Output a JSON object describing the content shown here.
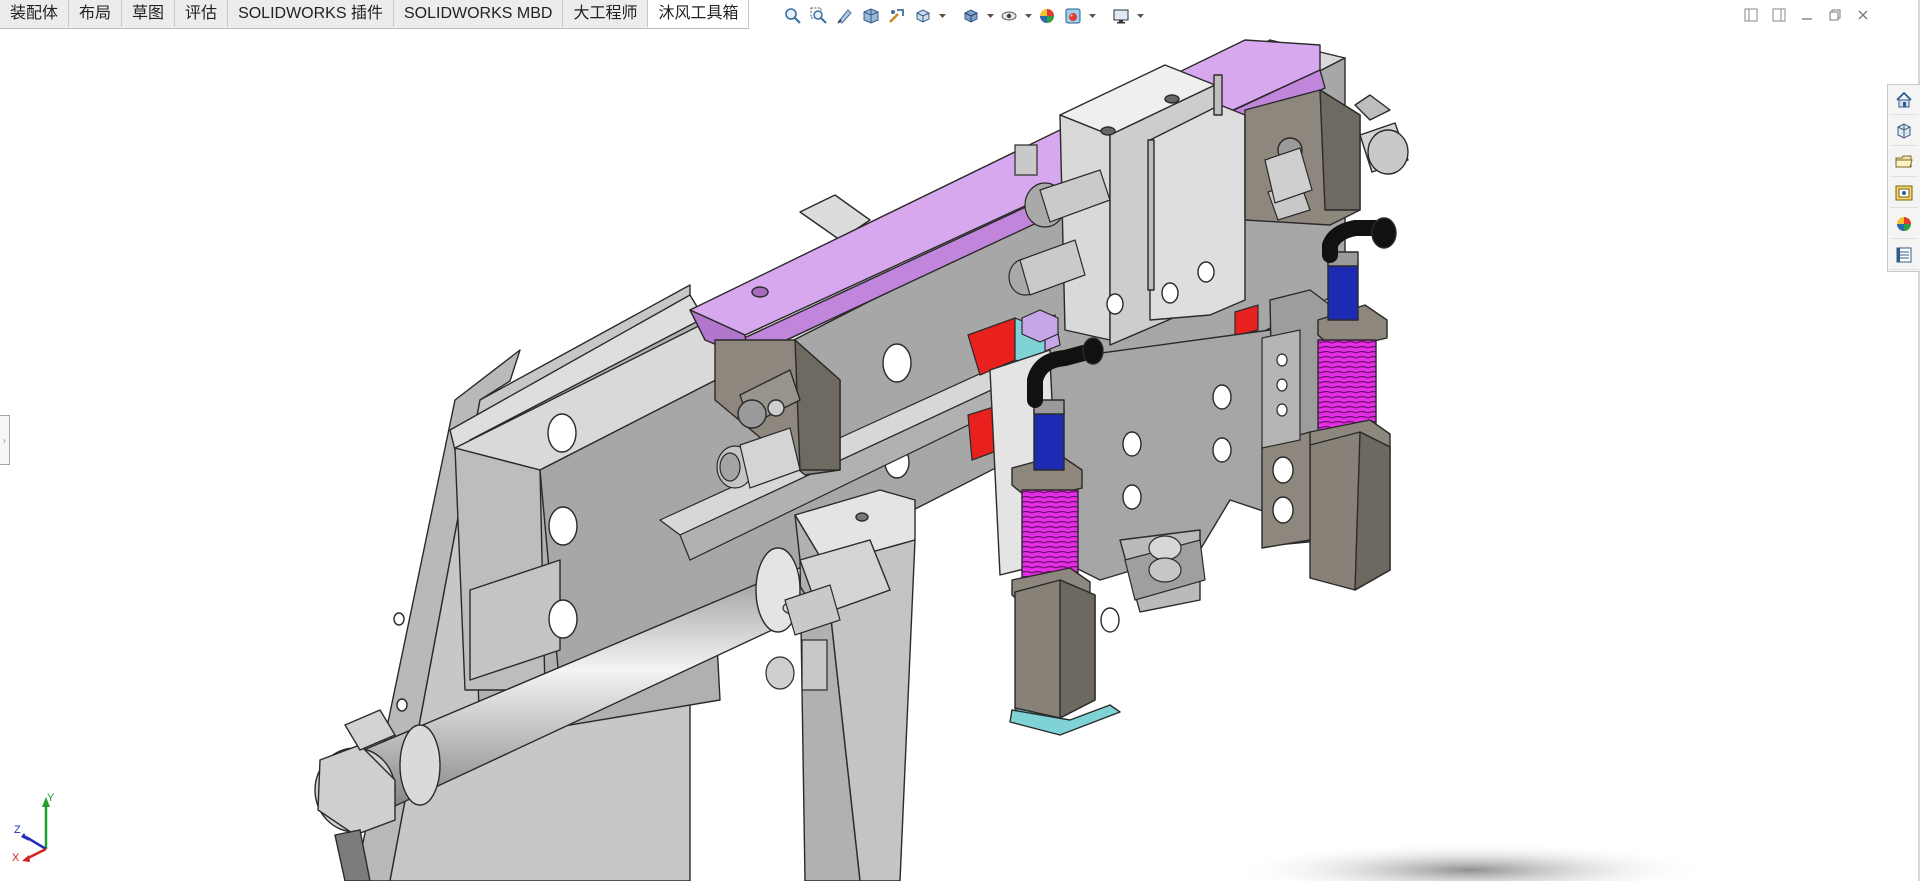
{
  "command_tabs": [
    {
      "label": "装配体",
      "active": false
    },
    {
      "label": "布局",
      "active": false
    },
    {
      "label": "草图",
      "active": false
    },
    {
      "label": "评估",
      "active": false
    },
    {
      "label": "SOLIDWORKS 插件",
      "active": false
    },
    {
      "label": "SOLIDWORKS MBD",
      "active": false
    },
    {
      "label": "大工程师",
      "active": false
    },
    {
      "label": "沐风工具箱",
      "active": true
    }
  ],
  "view_toolbar": [
    "zoom-to-fit-icon",
    "zoom-to-area-icon",
    "previous-view-icon",
    "section-view-icon",
    "dynamic-annotation-icon",
    "view-orientation-icon",
    "display-style-icon",
    "hide-show-items-icon",
    "edit-appearance-icon",
    "apply-scene-icon",
    "view-settings-icon"
  ],
  "task_pane": [
    "solidworks-resources-icon",
    "design-library-icon",
    "file-explorer-icon",
    "view-palette-icon",
    "appearances-scenes-icon",
    "custom-properties-icon"
  ],
  "triad_labels": {
    "x": "X",
    "y": "Y",
    "z": "Z"
  },
  "colors": {
    "accent_purple": "#d8a8ee",
    "spring_magenta": "#e62ee6",
    "fitting_blue": "#1d2ab4",
    "block_red": "#e8201e",
    "teal": "#7fd3d6",
    "steel": "#c8c8c8",
    "dark_steel": "#8a8479"
  }
}
